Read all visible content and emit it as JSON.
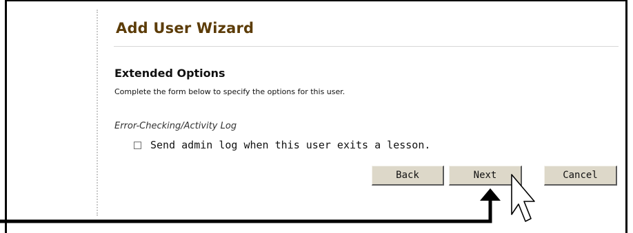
{
  "wizard": {
    "title": "Add User Wizard",
    "section_title": "Extended Options",
    "description": "Complete the form below to specify the options for this user.",
    "group_label": "Error-Checking/Activity Log",
    "checkbox": {
      "label": "Send admin log when this user exits a lesson.",
      "checked": false
    },
    "buttons": {
      "back": "Back",
      "next": "Next",
      "cancel": "Cancel"
    }
  },
  "icons": {
    "cursor": "mouse-pointer-icon",
    "callout": "arrow-up-icon"
  },
  "colors": {
    "title": "#5c3c08",
    "button_face": "#ddd8c9",
    "frame": "#000000"
  }
}
